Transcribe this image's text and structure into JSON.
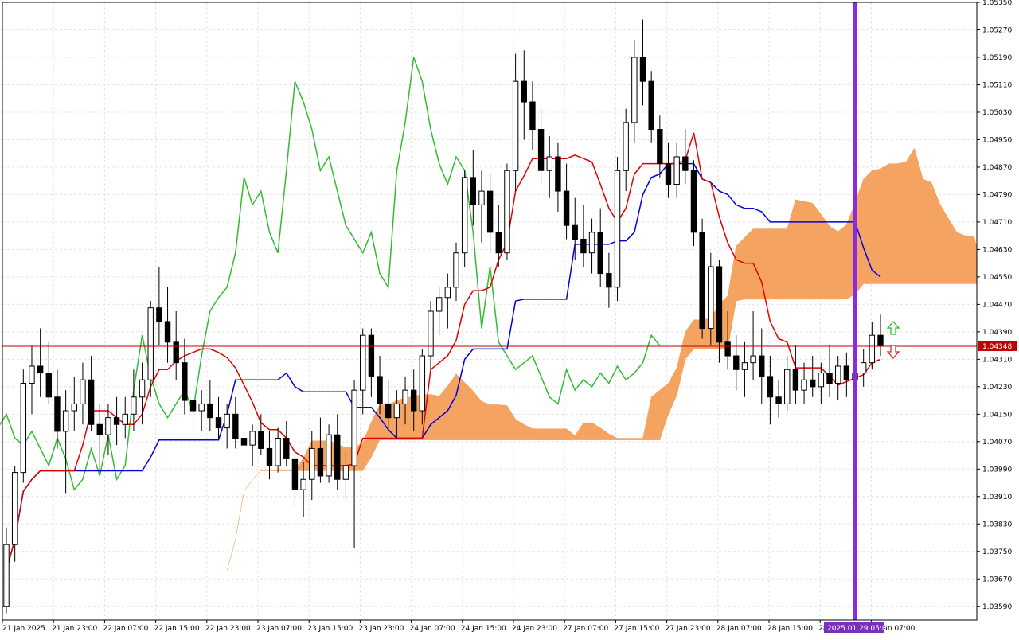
{
  "chart_data": {
    "type": "candlestick",
    "ylim": [
      1.0355,
      1.0535
    ],
    "y_ticks": [
      "1.05350",
      "1.05270",
      "1.05190",
      "1.05110",
      "1.05030",
      "1.04950",
      "1.04870",
      "1.04790",
      "1.04710",
      "1.04630",
      "1.04550",
      "1.04470",
      "1.04390",
      "1.04310",
      "1.04230",
      "1.04150",
      "1.04070",
      "1.03990",
      "1.03910",
      "1.03830",
      "1.03750",
      "1.03670",
      "1.03590"
    ],
    "x_ticks": [
      "21 Jan 2025",
      "21 Jan 23:00",
      "22 Jan 07:00",
      "22 Jan 15:00",
      "22 Jan 23:00",
      "23 Jan 07:00",
      "23 Jan 15:00",
      "23 Jan 23:00",
      "24 Jan 07:00",
      "24 Jan 15:00",
      "24 Jan 23:00",
      "27 Jan 07:00",
      "27 Jan 15:00",
      "27 Jan 23:00",
      "28 Jan 07:00",
      "28 Jan 15:00",
      "28",
      "29 Jan 07:00"
    ],
    "current_price": {
      "label": "1.04348",
      "value": 1.04348
    },
    "current_time_label": "2025.01.29 05:00",
    "grid": true,
    "colors": {
      "bull_candle": "#ffffff",
      "bear_candle": "#000000",
      "candle_outline": "#000000",
      "tenkan": "#e00000",
      "kijun": "#0000e0",
      "chikou": "#33bb33",
      "kumo_bull": "#f4a460",
      "kumo_bear": "#d8bfd8",
      "vline": "#8a2be2",
      "price_line": "#c00000",
      "price_badge": "#c00000",
      "time_badge": "#7b2fbe",
      "arrow_up": "#22bb22",
      "arrow_down": "#e02020"
    },
    "candles": [
      [
        1.0359,
        1.0382,
        1.0357,
        1.0377
      ],
      [
        1.0377,
        1.04,
        1.0372,
        1.0398
      ],
      [
        1.0398,
        1.0428,
        1.0395,
        1.0424
      ],
      [
        1.0424,
        1.0435,
        1.0415,
        1.0429
      ],
      [
        1.0429,
        1.044,
        1.042,
        1.0427
      ],
      [
        1.0427,
        1.0436,
        1.0418,
        1.042
      ],
      [
        1.042,
        1.0428,
        1.0405,
        1.041
      ],
      [
        1.041,
        1.0422,
        1.0392,
        1.0416
      ],
      [
        1.0416,
        1.0426,
        1.041,
        1.0418
      ],
      [
        1.0418,
        1.043,
        1.0412,
        1.0425
      ],
      [
        1.0425,
        1.0432,
        1.041,
        1.0412
      ],
      [
        1.0412,
        1.0418,
        1.0398,
        1.0409
      ],
      [
        1.0409,
        1.0418,
        1.0403,
        1.0414
      ],
      [
        1.0414,
        1.042,
        1.0406,
        1.0412
      ],
      [
        1.0412,
        1.042,
        1.0408,
        1.0415
      ],
      [
        1.0415,
        1.0428,
        1.041,
        1.042
      ],
      [
        1.042,
        1.043,
        1.0412,
        1.0425
      ],
      [
        1.0425,
        1.0448,
        1.042,
        1.0446
      ],
      [
        1.0446,
        1.0458,
        1.0435,
        1.0442
      ],
      [
        1.0442,
        1.0452,
        1.043,
        1.0436
      ],
      [
        1.0436,
        1.0445,
        1.0425,
        1.043
      ],
      [
        1.043,
        1.0437,
        1.0415,
        1.0419
      ],
      [
        1.0419,
        1.0425,
        1.041,
        1.0416
      ],
      [
        1.0416,
        1.0422,
        1.041,
        1.0418
      ],
      [
        1.0418,
        1.0425,
        1.041,
        1.0414
      ],
      [
        1.0414,
        1.042,
        1.0408,
        1.0411
      ],
      [
        1.0411,
        1.0418,
        1.0405,
        1.0415
      ],
      [
        1.0415,
        1.042,
        1.0405,
        1.0408
      ],
      [
        1.0408,
        1.0415,
        1.0402,
        1.0406
      ],
      [
        1.0406,
        1.0412,
        1.04,
        1.041
      ],
      [
        1.041,
        1.0415,
        1.0403,
        1.0405
      ],
      [
        1.0405,
        1.041,
        1.0396,
        1.04
      ],
      [
        1.04,
        1.0411,
        1.0398,
        1.0408
      ],
      [
        1.0408,
        1.0413,
        1.04,
        1.0402
      ],
      [
        1.0402,
        1.0406,
        1.0388,
        1.0393
      ],
      [
        1.0393,
        1.0401,
        1.0385,
        1.0396
      ],
      [
        1.0396,
        1.041,
        1.039,
        1.0405
      ],
      [
        1.0405,
        1.0414,
        1.0395,
        1.0397
      ],
      [
        1.0397,
        1.0412,
        1.0395,
        1.0409
      ],
      [
        1.0409,
        1.0415,
        1.0393,
        1.0396
      ],
      [
        1.0396,
        1.0404,
        1.039,
        1.04
      ],
      [
        1.04,
        1.0425,
        1.0376,
        1.0422
      ],
      [
        1.0422,
        1.044,
        1.0415,
        1.0438
      ],
      [
        1.0438,
        1.044,
        1.042,
        1.0426
      ],
      [
        1.0426,
        1.0432,
        1.0415,
        1.0418
      ],
      [
        1.0418,
        1.0425,
        1.041,
        1.0414
      ],
      [
        1.0414,
        1.0422,
        1.0408,
        1.0418
      ],
      [
        1.0418,
        1.0426,
        1.0412,
        1.0422
      ],
      [
        1.0422,
        1.0428,
        1.041,
        1.0416
      ],
      [
        1.0416,
        1.0434,
        1.0412,
        1.0432
      ],
      [
        1.0432,
        1.0448,
        1.0428,
        1.0445
      ],
      [
        1.0445,
        1.0452,
        1.0438,
        1.0449
      ],
      [
        1.0449,
        1.0456,
        1.044,
        1.0452
      ],
      [
        1.0452,
        1.0465,
        1.0448,
        1.0462
      ],
      [
        1.0462,
        1.0486,
        1.0458,
        1.0484
      ],
      [
        1.0484,
        1.0492,
        1.047,
        1.0476
      ],
      [
        1.0476,
        1.0486,
        1.0465,
        1.048
      ],
      [
        1.048,
        1.0485,
        1.0462,
        1.0468
      ],
      [
        1.0468,
        1.0476,
        1.0458,
        1.0462
      ],
      [
        1.0462,
        1.0488,
        1.046,
        1.0486
      ],
      [
        1.0486,
        1.052,
        1.048,
        1.0512
      ],
      [
        1.0512,
        1.0521,
        1.0495,
        1.0506
      ],
      [
        1.0506,
        1.0512,
        1.0492,
        1.0498
      ],
      [
        1.0498,
        1.0504,
        1.0482,
        1.0486
      ],
      [
        1.0486,
        1.0496,
        1.0478,
        1.049
      ],
      [
        1.049,
        1.0494,
        1.0474,
        1.048
      ],
      [
        1.048,
        1.0488,
        1.0466,
        1.047
      ],
      [
        1.047,
        1.0478,
        1.046,
        1.0466
      ],
      [
        1.0466,
        1.0476,
        1.0458,
        1.0462
      ],
      [
        1.0462,
        1.0472,
        1.0456,
        1.0468
      ],
      [
        1.0468,
        1.0475,
        1.0452,
        1.0456
      ],
      [
        1.0456,
        1.0462,
        1.0446,
        1.0452
      ],
      [
        1.0452,
        1.049,
        1.0448,
        1.0486
      ],
      [
        1.0486,
        1.0504,
        1.048,
        1.05
      ],
      [
        1.05,
        1.0524,
        1.0494,
        1.0519
      ],
      [
        1.0519,
        1.053,
        1.0505,
        1.0512
      ],
      [
        1.0512,
        1.0515,
        1.0494,
        1.0498
      ],
      [
        1.0498,
        1.0502,
        1.0484,
        1.0488
      ],
      [
        1.0488,
        1.0494,
        1.0478,
        1.0482
      ],
      [
        1.0482,
        1.0494,
        1.0478,
        1.049
      ],
      [
        1.049,
        1.0498,
        1.0482,
        1.0486
      ],
      [
        1.0486,
        1.0489,
        1.0464,
        1.0468
      ],
      [
        1.0468,
        1.0472,
        1.0437,
        1.044
      ],
      [
        1.044,
        1.0462,
        1.0435,
        1.0458
      ],
      [
        1.0458,
        1.046,
        1.043,
        1.0436
      ],
      [
        1.0436,
        1.0445,
        1.0428,
        1.0432
      ],
      [
        1.0432,
        1.0438,
        1.0422,
        1.0428
      ],
      [
        1.0428,
        1.0436,
        1.042,
        1.043
      ],
      [
        1.043,
        1.0445,
        1.0425,
        1.0432
      ],
      [
        1.0432,
        1.044,
        1.0418,
        1.0426
      ],
      [
        1.0426,
        1.0432,
        1.0412,
        1.042
      ],
      [
        1.042,
        1.0425,
        1.0414,
        1.0418
      ],
      [
        1.0418,
        1.0432,
        1.0416,
        1.0428
      ],
      [
        1.0428,
        1.0435,
        1.0418,
        1.0422
      ],
      [
        1.0422,
        1.043,
        1.0418,
        1.0425
      ],
      [
        1.0425,
        1.0432,
        1.042,
        1.0423
      ],
      [
        1.0423,
        1.043,
        1.0418,
        1.0427
      ],
      [
        1.0427,
        1.0435,
        1.042,
        1.0424
      ],
      [
        1.0424,
        1.0432,
        1.0419,
        1.0429
      ],
      [
        1.0429,
        1.0433,
        1.042,
        1.0425
      ],
      [
        1.0425,
        1.0432,
        1.0422,
        1.0427
      ],
      [
        1.0427,
        1.0434,
        1.0423,
        1.043
      ],
      [
        1.043,
        1.0442,
        1.0428,
        1.0438
      ],
      [
        1.0438,
        1.0444,
        1.0432,
        1.0435
      ]
    ]
  },
  "labels": {
    "price_badge": "1.04348",
    "time_badge": "2025.01.29 05:00"
  }
}
